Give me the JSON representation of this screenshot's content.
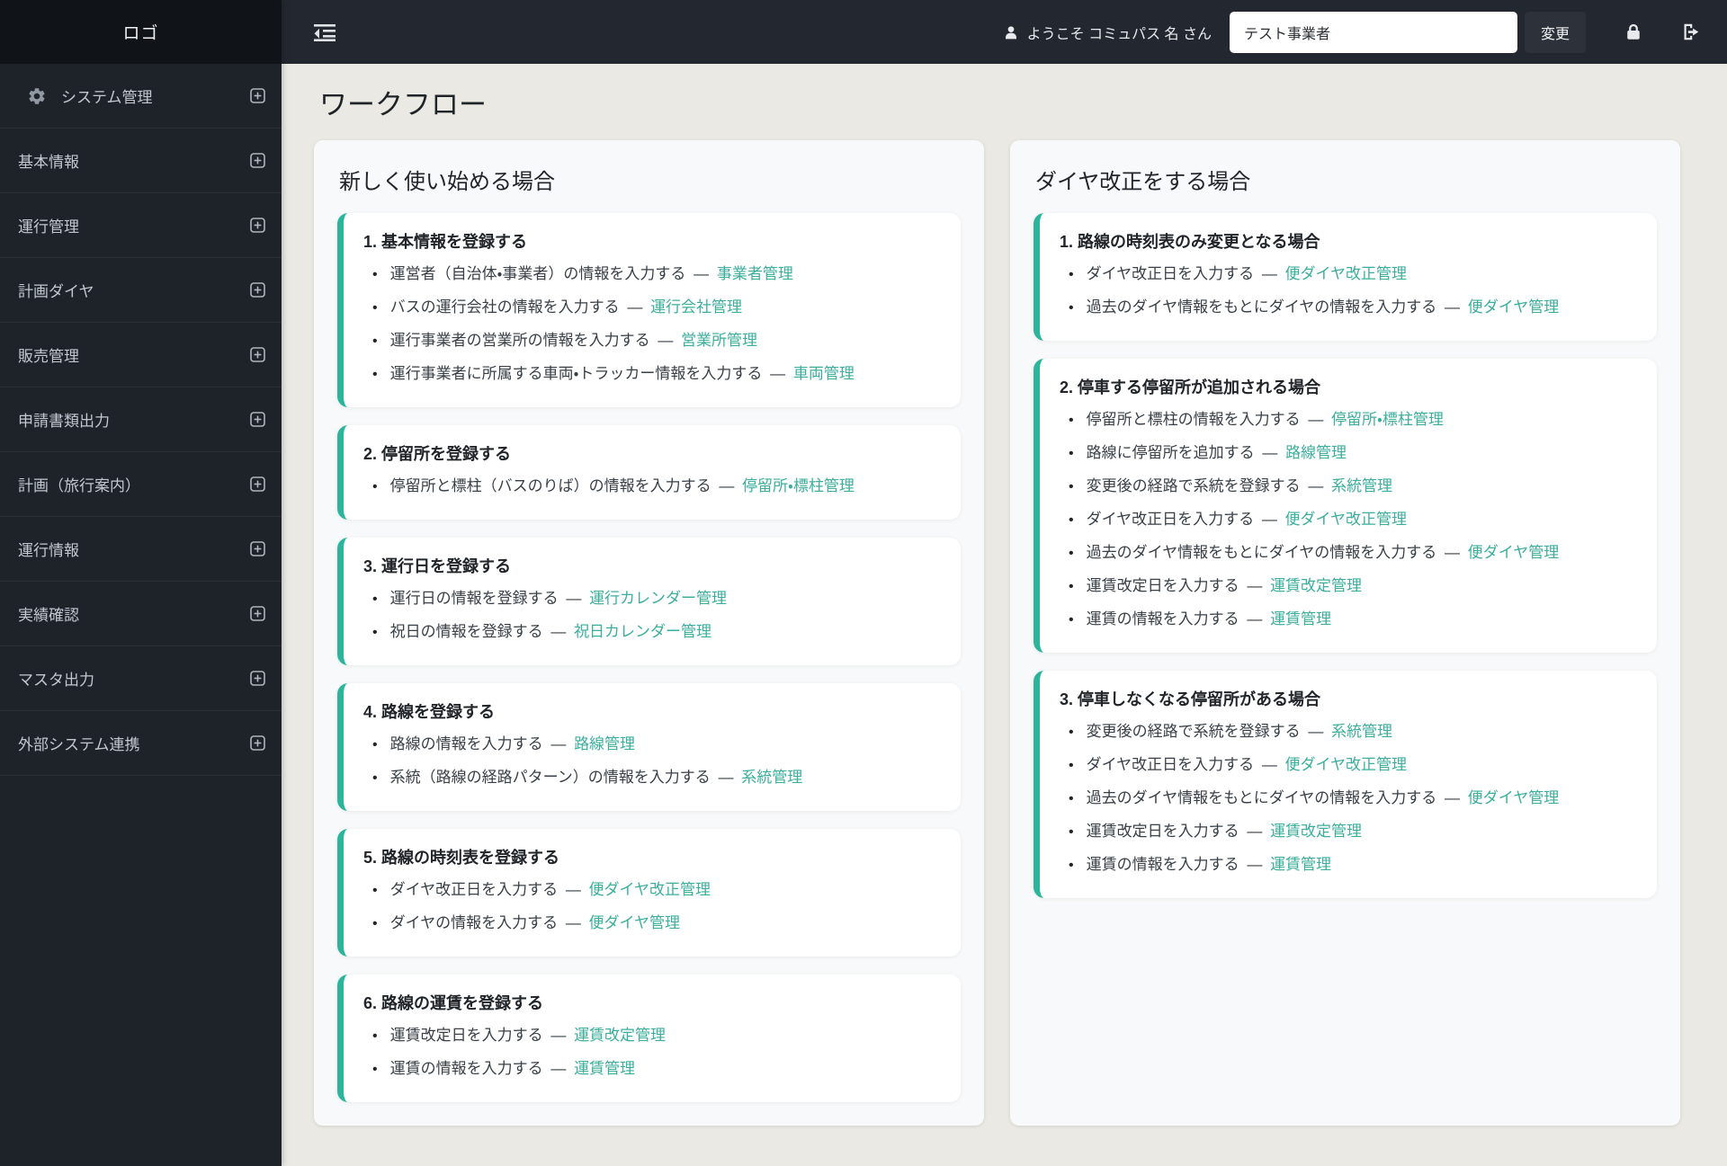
{
  "sidebar": {
    "logo": "ロゴ",
    "items": [
      {
        "label": "システム管理",
        "gear": true
      },
      {
        "label": "基本情報"
      },
      {
        "label": "運行管理"
      },
      {
        "label": "計画ダイヤ"
      },
      {
        "label": "販売管理"
      },
      {
        "label": "申請書類出力"
      },
      {
        "label": "計画（旅行案内）"
      },
      {
        "label": "運行情報"
      },
      {
        "label": "実績確認"
      },
      {
        "label": "マスタ出力"
      },
      {
        "label": "外部システム連携"
      }
    ]
  },
  "topbar": {
    "greeting": "ようこそ コミュパス 名 さん",
    "operator_input_value": "テスト事業者",
    "change_button": "変更",
    "icons": [
      "user-icon",
      "outdent-icon",
      "lock-icon",
      "sign-out-icon"
    ]
  },
  "page": {
    "title": "ワークフロー",
    "bullet": "•",
    "dash": "—",
    "accent_color": "#2cb59b",
    "link_color": "#3cae9c",
    "cards": [
      {
        "title": "新しく使い始める場合",
        "sections": [
          {
            "heading": "1. 基本情報を登録する",
            "items": [
              {
                "text": "運営者（自治体・事業者）の情報を入力する",
                "link": "事業者管理"
              },
              {
                "text": "バスの運行会社の情報を入力する",
                "link": "運行会社管理"
              },
              {
                "text": "運行事業者の営業所の情報を入力する",
                "link": "営業所管理"
              },
              {
                "text": "運行事業者に所属する車両・トラッカー情報を入力する",
                "link": "車両管理"
              }
            ]
          },
          {
            "heading": "2. 停留所を登録する",
            "items": [
              {
                "text": "停留所と標柱（バスのりば）の情報を入力する",
                "link": "停留所・標柱管理"
              }
            ]
          },
          {
            "heading": "3. 運行日を登録する",
            "items": [
              {
                "text": "運行日の情報を登録する",
                "link": "運行カレンダー管理"
              },
              {
                "text": "祝日の情報を登録する",
                "link": "祝日カレンダー管理"
              }
            ]
          },
          {
            "heading": "4. 路線を登録する",
            "items": [
              {
                "text": "路線の情報を入力する",
                "link": "路線管理"
              },
              {
                "text": "系統（路線の経路パターン）の情報を入力する",
                "link": "系統管理"
              }
            ]
          },
          {
            "heading": "5. 路線の時刻表を登録する",
            "items": [
              {
                "text": "ダイヤ改正日を入力する",
                "link": "便ダイヤ改正管理"
              },
              {
                "text": "ダイヤの情報を入力する",
                "link": "便ダイヤ管理"
              }
            ]
          },
          {
            "heading": "6. 路線の運賃を登録する",
            "items": [
              {
                "text": "運賃改定日を入力する",
                "link": "運賃改定管理"
              },
              {
                "text": "運賃の情報を入力する",
                "link": "運賃管理"
              }
            ]
          }
        ]
      },
      {
        "title": "ダイヤ改正をする場合",
        "sections": [
          {
            "heading": "1. 路線の時刻表のみ変更となる場合",
            "items": [
              {
                "text": "ダイヤ改正日を入力する",
                "link": "便ダイヤ改正管理"
              },
              {
                "text": "過去のダイヤ情報をもとにダイヤの情報を入力する",
                "link": "便ダイヤ管理"
              }
            ]
          },
          {
            "heading": "2. 停車する停留所が追加される場合",
            "items": [
              {
                "text": "停留所と標柱の情報を入力する",
                "link": "停留所・標柱管理"
              },
              {
                "text": "路線に停留所を追加する",
                "link": "路線管理"
              },
              {
                "text": "変更後の経路で系統を登録する",
                "link": "系統管理"
              },
              {
                "text": "ダイヤ改正日を入力する",
                "link": "便ダイヤ改正管理"
              },
              {
                "text": "過去のダイヤ情報をもとにダイヤの情報を入力する",
                "link": "便ダイヤ管理"
              },
              {
                "text": "運賃改定日を入力する",
                "link": "運賃改定管理"
              },
              {
                "text": "運賃の情報を入力する",
                "link": "運賃管理"
              }
            ]
          },
          {
            "heading": "3. 停車しなくなる停留所がある場合",
            "items": [
              {
                "text": "変更後の経路で系統を登録する",
                "link": "系統管理"
              },
              {
                "text": "ダイヤ改正日を入力する",
                "link": "便ダイヤ改正管理"
              },
              {
                "text": "過去のダイヤ情報をもとにダイヤの情報を入力する",
                "link": "便ダイヤ管理"
              },
              {
                "text": "運賃改定日を入力する",
                "link": "運賃改定管理"
              },
              {
                "text": "運賃の情報を入力する",
                "link": "運賃管理"
              }
            ]
          }
        ]
      }
    ]
  }
}
